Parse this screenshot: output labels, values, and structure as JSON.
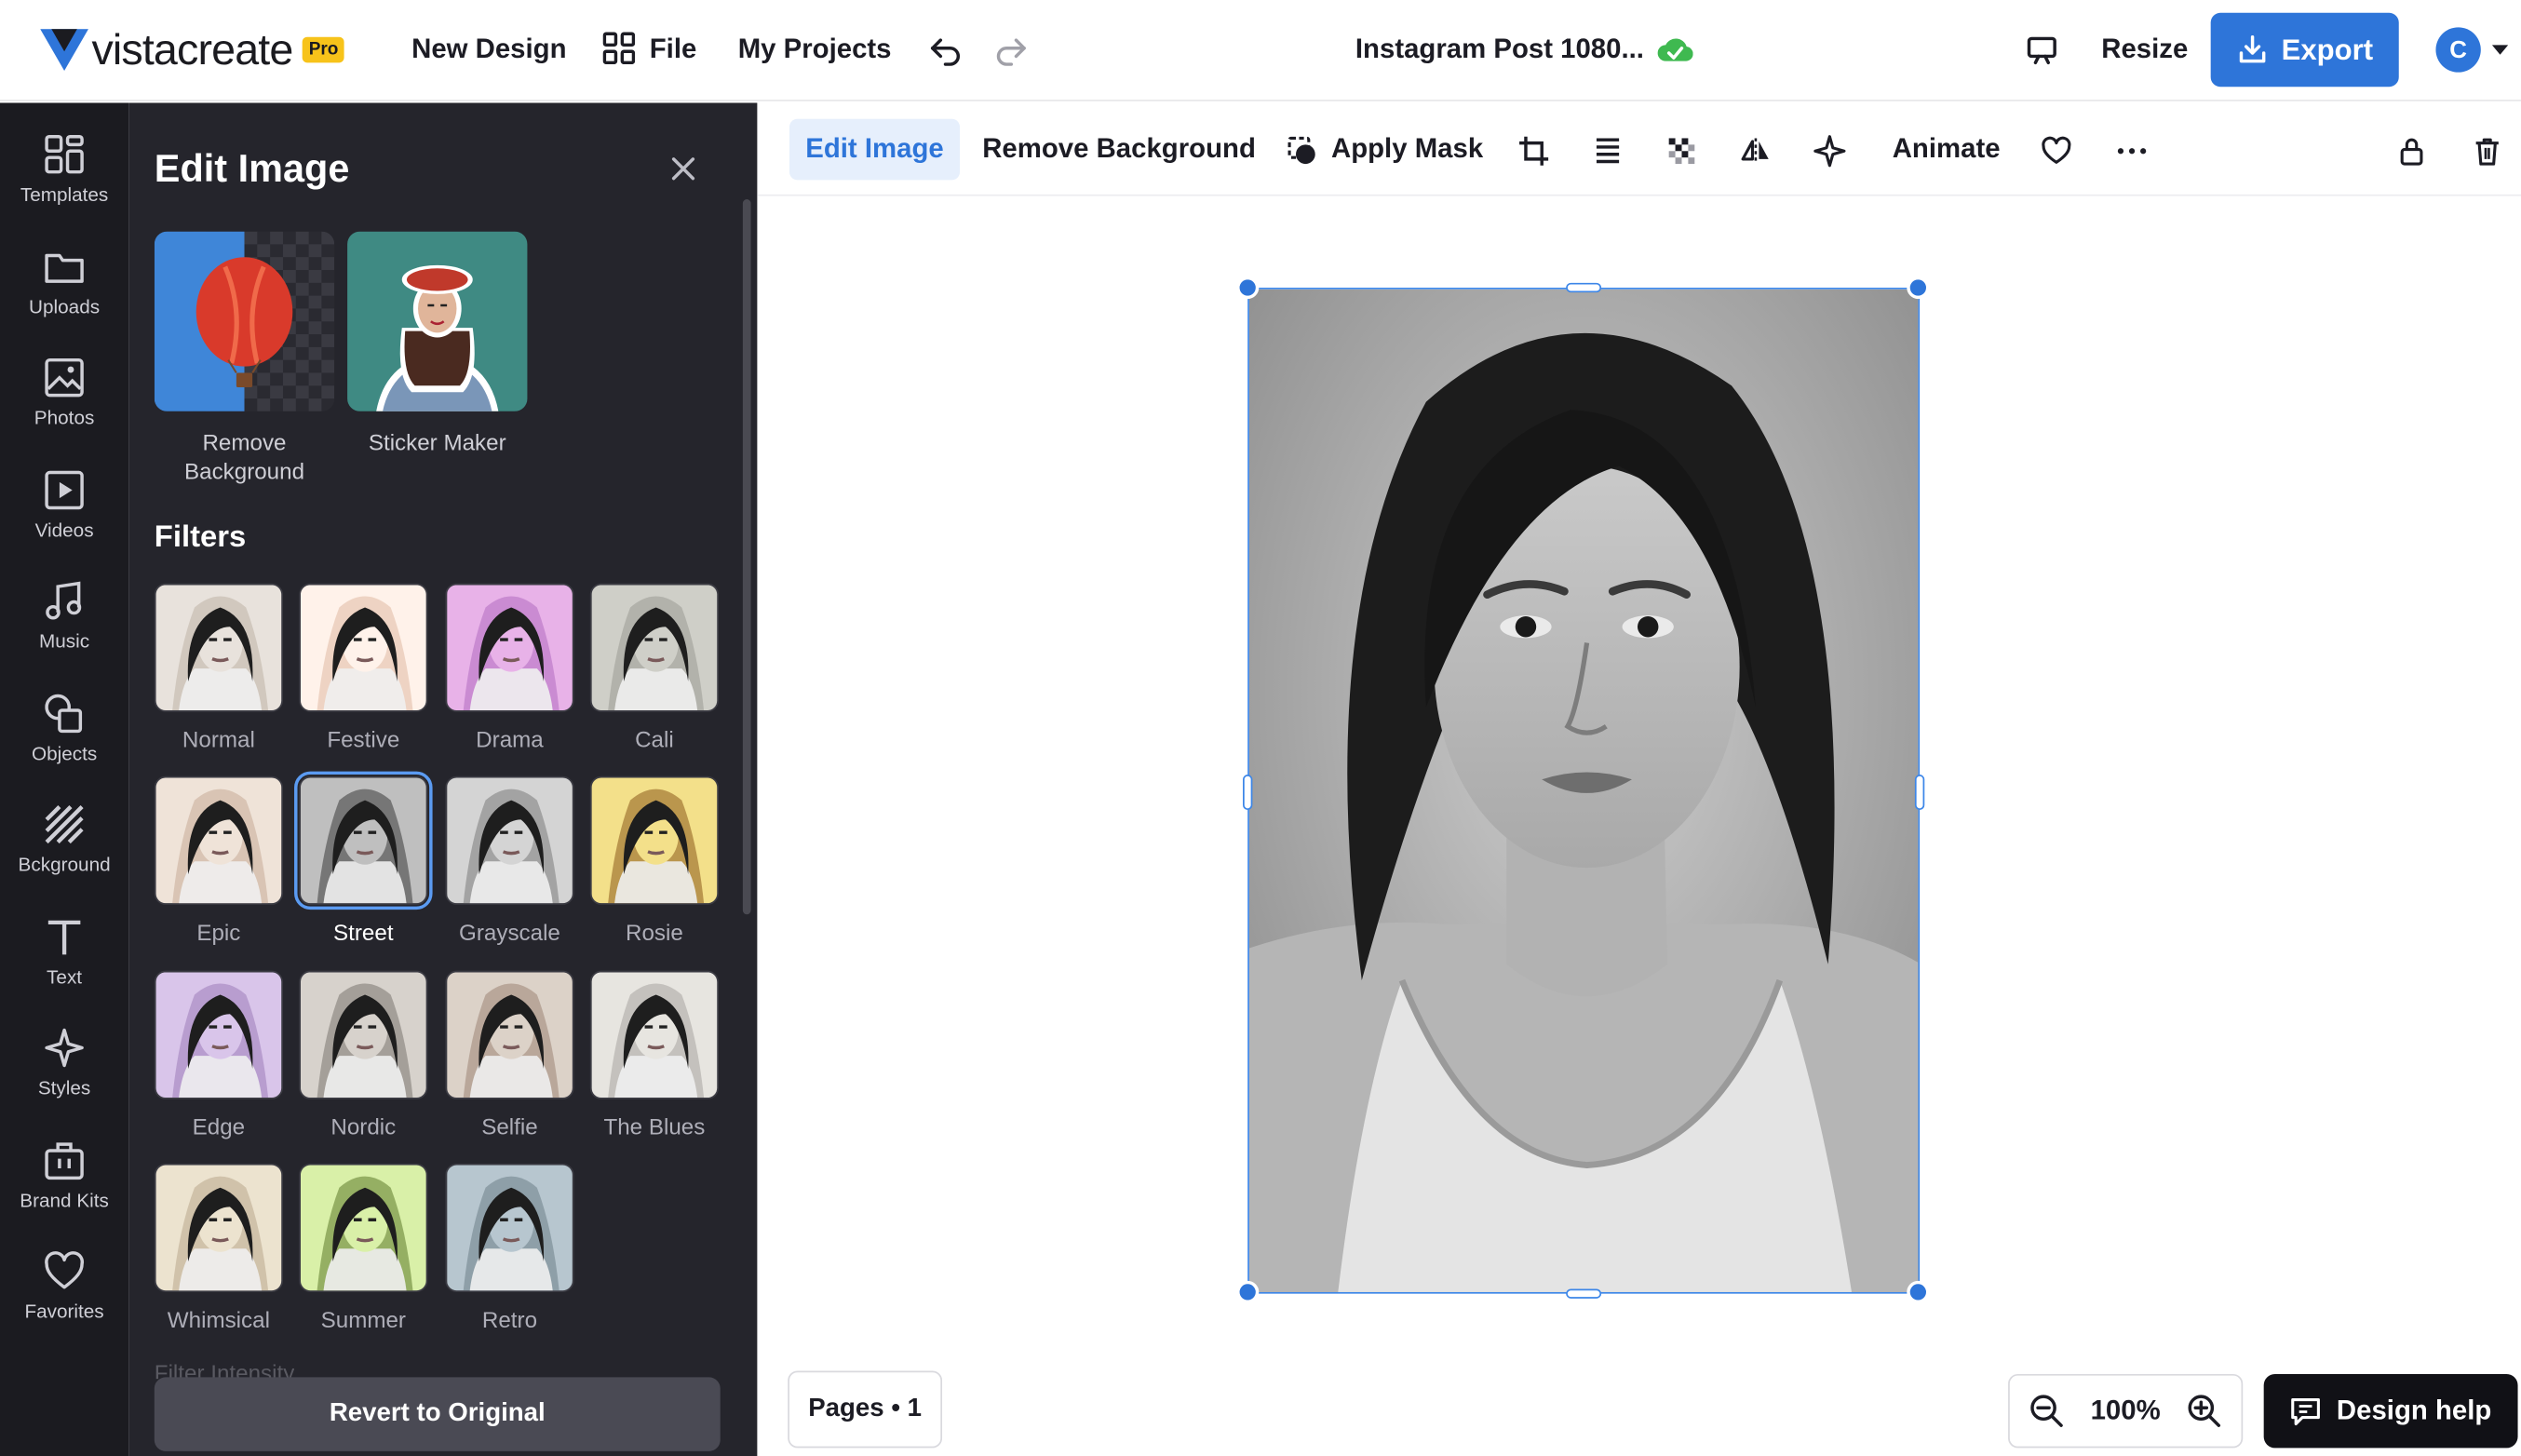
{
  "topbar": {
    "brand_name": "vistacreate",
    "pro_badge": "Pro",
    "new_design": "New Design",
    "file": "File",
    "my_projects": "My Projects",
    "doc_title": "Instagram Post 1080...",
    "resize": "Resize",
    "export": "Export",
    "avatar_initial": "C"
  },
  "rail": {
    "items": [
      {
        "label": "Templates",
        "icon": "templates-icon"
      },
      {
        "label": "Uploads",
        "icon": "folder-icon"
      },
      {
        "label": "Photos",
        "icon": "image-icon"
      },
      {
        "label": "Videos",
        "icon": "play-icon"
      },
      {
        "label": "Music",
        "icon": "music-note-icon"
      },
      {
        "label": "Objects",
        "icon": "shapes-icon"
      },
      {
        "label": "Bckground",
        "icon": "background-stripes-icon"
      },
      {
        "label": "Text",
        "icon": "text-t-icon"
      },
      {
        "label": "Styles",
        "icon": "sparkle-icon"
      },
      {
        "label": "Brand Kits",
        "icon": "briefcase-icon"
      },
      {
        "label": "Favorites",
        "icon": "heart-icon"
      }
    ]
  },
  "panel": {
    "title": "Edit Image",
    "tools": [
      {
        "label": "Remove Background"
      },
      {
        "label": "Sticker Maker"
      }
    ],
    "filters_title": "Filters",
    "filters": [
      {
        "label": "Normal"
      },
      {
        "label": "Festive"
      },
      {
        "label": "Drama"
      },
      {
        "label": "Cali"
      },
      {
        "label": "Epic"
      },
      {
        "label": "Street"
      },
      {
        "label": "Grayscale"
      },
      {
        "label": "Rosie"
      },
      {
        "label": "Edge"
      },
      {
        "label": "Nordic"
      },
      {
        "label": "Selfie"
      },
      {
        "label": "The Blues"
      },
      {
        "label": "Whimsical"
      },
      {
        "label": "Summer"
      },
      {
        "label": "Retro"
      }
    ],
    "selected_filter": "Street",
    "intensity_label": "Filter Intensity",
    "revert": "Revert to Original"
  },
  "context_toolbar": {
    "edit_image": "Edit Image",
    "remove_background": "Remove Background",
    "apply_mask": "Apply Mask",
    "animate": "Animate"
  },
  "canvas": {
    "pages": "Pages • 1",
    "zoom": "100%",
    "design_help": "Design help"
  },
  "colors": {
    "accent": "#2e75d9",
    "dark_panel": "#25252c",
    "rail": "#1b1b20",
    "pro_badge": "#f7c31a",
    "sync_ok": "#3fb950"
  }
}
